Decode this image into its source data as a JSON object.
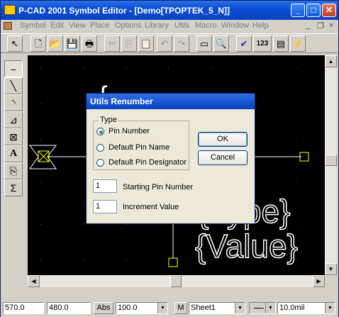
{
  "window": {
    "title": "P-CAD 2001 Symbol Editor - [Demo[TPOPTEK_5_N]]",
    "min": "_",
    "max": "□",
    "close": "✕"
  },
  "menu": {
    "items": [
      "Symbol",
      "Edit",
      "View",
      "Place",
      "Options",
      "Library",
      "Utils",
      "Macro",
      "Window",
      "Help"
    ],
    "mdi_min": "_",
    "mdi_restore": "❐",
    "mdi_close": "×"
  },
  "toolbar": {
    "buttons": [
      "↖",
      "🗋",
      "📂",
      "💾",
      "🖶",
      "✂",
      "⎘",
      "📋",
      "↶",
      "↷",
      "▭",
      "🔍",
      "✔",
      "123",
      "▤",
      "⚡"
    ]
  },
  "left_tools": [
    "⎯",
    "╲",
    "◝",
    "⊿",
    "⊠",
    "A",
    "⎘",
    "Σ"
  ],
  "canvas": {
    "text_type": "{Type}",
    "text_value": "{Value}",
    "text_fragment": "{",
    "colors": {
      "bg": "#000000",
      "text": "#ffffff",
      "pin_box": "#ffff00"
    }
  },
  "dialog": {
    "title": "Utils Renumber",
    "group_label": "Type",
    "options": [
      "Pin Number",
      "Default Pin Name",
      "Default Pin Designator"
    ],
    "selected_option": "Pin Number",
    "ok_label": "OK",
    "cancel_label": "Cancel",
    "start_value": "1",
    "start_label": "Starting Pin Number",
    "increment_value": "1",
    "increment_label": "Increment Value"
  },
  "status": {
    "x": "570.0",
    "y": "480.0",
    "abs": "Abs",
    "grid": "100.0",
    "m": "M",
    "sheet": "Sheet1",
    "line_width": "10.0mil"
  }
}
